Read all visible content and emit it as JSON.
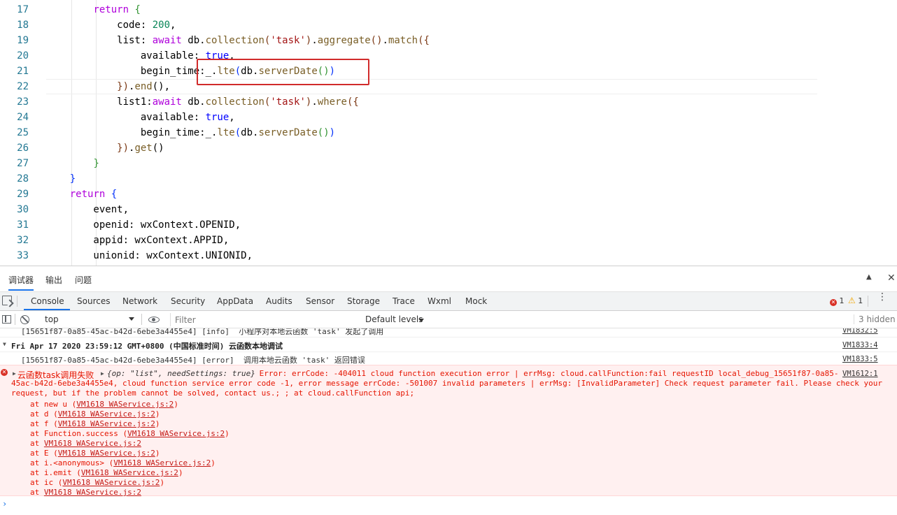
{
  "editor": {
    "line_numbers": [
      "17",
      "18",
      "19",
      "20",
      "21",
      "22",
      "23",
      "24",
      "25",
      "26",
      "27",
      "28",
      "29",
      "30",
      "31",
      "32",
      "33"
    ],
    "lines": [
      [
        {
          "t": "        "
        },
        {
          "t": "return",
          "c": "kw2"
        },
        {
          "t": " "
        },
        {
          "t": "{",
          "c": "br2"
        }
      ],
      [
        {
          "t": "            code: "
        },
        {
          "t": "200",
          "c": "num"
        },
        {
          "t": ","
        }
      ],
      [
        {
          "t": "            list: "
        },
        {
          "t": "await",
          "c": "kw2"
        },
        {
          "t": " db."
        },
        {
          "t": "collection",
          "c": "fn"
        },
        {
          "t": "(",
          "c": "br3"
        },
        {
          "t": "'task'",
          "c": "str"
        },
        {
          "t": ")",
          "c": "br3"
        },
        {
          "t": "."
        },
        {
          "t": "aggregate",
          "c": "fn"
        },
        {
          "t": "()",
          "c": "br3"
        },
        {
          "t": "."
        },
        {
          "t": "match",
          "c": "fn"
        },
        {
          "t": "({",
          "c": "br3"
        }
      ],
      [
        {
          "t": "                available: "
        },
        {
          "t": "true",
          "c": "bool"
        },
        {
          "t": ","
        }
      ],
      [
        {
          "t": "                begin_time:_."
        },
        {
          "t": "lte",
          "c": "fn"
        },
        {
          "t": "(",
          "c": "br1"
        },
        {
          "t": "db."
        },
        {
          "t": "serverDate",
          "c": "fn"
        },
        {
          "t": "()",
          "c": "br2"
        },
        {
          "t": ")",
          "c": "br1"
        }
      ],
      [
        {
          "t": "            "
        },
        {
          "t": "})",
          "c": "br3"
        },
        {
          "t": "."
        },
        {
          "t": "end",
          "c": "fn"
        },
        {
          "t": "(),"
        }
      ],
      [
        {
          "t": "            list1:"
        },
        {
          "t": "await",
          "c": "kw2"
        },
        {
          "t": " db."
        },
        {
          "t": "collection",
          "c": "fn"
        },
        {
          "t": "(",
          "c": "br3"
        },
        {
          "t": "'task'",
          "c": "str"
        },
        {
          "t": ")",
          "c": "br3"
        },
        {
          "t": "."
        },
        {
          "t": "where",
          "c": "fn"
        },
        {
          "t": "({",
          "c": "br3"
        }
      ],
      [
        {
          "t": "                available: "
        },
        {
          "t": "true",
          "c": "bool"
        },
        {
          "t": ","
        }
      ],
      [
        {
          "t": "                begin_time:_."
        },
        {
          "t": "lte",
          "c": "fn"
        },
        {
          "t": "(",
          "c": "br1"
        },
        {
          "t": "db."
        },
        {
          "t": "serverDate",
          "c": "fn"
        },
        {
          "t": "()",
          "c": "br2"
        },
        {
          "t": ")",
          "c": "br1"
        }
      ],
      [
        {
          "t": "            "
        },
        {
          "t": "})",
          "c": "br3"
        },
        {
          "t": "."
        },
        {
          "t": "get",
          "c": "fn"
        },
        {
          "t": "()"
        }
      ],
      [
        {
          "t": "        "
        },
        {
          "t": "}",
          "c": "br2"
        }
      ],
      [
        {
          "t": "    "
        },
        {
          "t": "}",
          "c": "br1"
        }
      ],
      [
        {
          "t": "    "
        },
        {
          "t": "return",
          "c": "kw2"
        },
        {
          "t": " "
        },
        {
          "t": "{",
          "c": "br1"
        }
      ],
      [
        {
          "t": "        event,"
        }
      ],
      [
        {
          "t": "        openid: wxContext.OPENID,"
        }
      ],
      [
        {
          "t": "        appid: wxContext.APPID,"
        }
      ],
      [
        {
          "t": "        unionid: wxContext.UNIONID,"
        }
      ]
    ]
  },
  "devtools": {
    "top_tabs": [
      "调试器",
      "输出",
      "问题"
    ],
    "panel_tabs": [
      "Console",
      "Sources",
      "Network",
      "Security",
      "AppData",
      "Audits",
      "Sensor",
      "Storage",
      "Trace",
      "Wxml",
      "Mock"
    ],
    "active_panel": "Console",
    "error_count": "1",
    "warning_count": "1",
    "context": "top",
    "filter_placeholder": "Filter",
    "levels": "Default levels",
    "hidden": "3 hidden"
  },
  "console": {
    "msg1": {
      "text": "[15651f87-0a85-45ac-b42d-6ebe3a4455e4] [info]  小程序对本地云函数 'task' 发起了调用",
      "src": "VM1832:5"
    },
    "group": {
      "text": "Fri Apr 17 2020 23:59:12 GMT+0800 (中国标准时间) 云函数本地调试",
      "src": "VM1833:4"
    },
    "msg2": {
      "text": "[15651f87-0a85-45ac-b42d-6ebe3a4455e4] [error]  调用本地云函数 'task' 返回错误",
      "src": "VM1833:5"
    },
    "error": {
      "line1": "云函数task调用失败 ",
      "obj": "{op: \"list\", needSettings: true}",
      "line1b": " Error: errCode: -404011 cloud function execution error | errMsg: cloud.callFunction:fail requestID local_debug_15651f87-0a85-",
      "line2": "45ac-b42d-6ebe3a4455e4, cloud function service error code -1, error message errCode: -501007 invalid parameters | errMsg: [InvalidParameter] Check request parameter fail. Please check your",
      "line3": "request, but if the problem cannot be solved, contact us.; ; at cloud.callFunction api;",
      "src": "VM1612:1",
      "stack": [
        {
          "pre": "at new u (",
          "link": "VM1618 WAService.js:2",
          "post": ")"
        },
        {
          "pre": "at d (",
          "link": "VM1618 WAService.js:2",
          "post": ")"
        },
        {
          "pre": "at f (",
          "link": "VM1618 WAService.js:2",
          "post": ")"
        },
        {
          "pre": "at Function.success (",
          "link": "VM1618 WAService.js:2",
          "post": ")"
        },
        {
          "pre": "at ",
          "link": "VM1618 WAService.js:2",
          "post": ""
        },
        {
          "pre": "at E (",
          "link": "VM1618 WAService.js:2",
          "post": ")"
        },
        {
          "pre": "at i.<anonymous> (",
          "link": "VM1618 WAService.js:2",
          "post": ")"
        },
        {
          "pre": "at i.emit (",
          "link": "VM1618 WAService.js:2",
          "post": ")"
        },
        {
          "pre": "at ic (",
          "link": "VM1618 WAService.js:2",
          "post": ")"
        },
        {
          "pre": "at ",
          "link": "VM1618 WAService.js:2",
          "post": ""
        }
      ]
    },
    "prompt": "›"
  }
}
